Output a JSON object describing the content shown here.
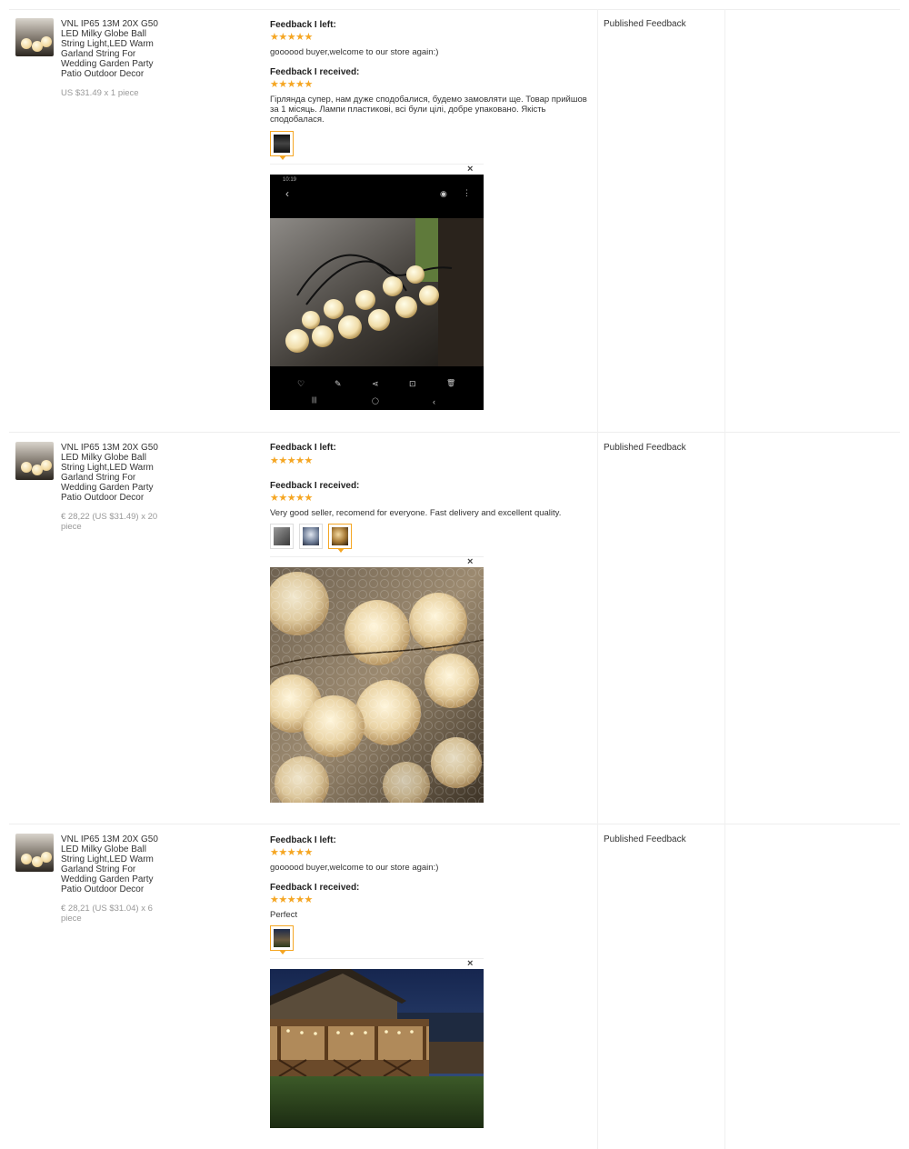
{
  "rows": [
    {
      "product_title": "VNL IP65 13M 20X G50 LED Milky Globe Ball String Light,LED Warm Garland String For Wedding Garden Party Patio Outdoor Decor",
      "price": "US $31.49 x 1 piece",
      "left_label": "Feedback I left:",
      "left_stars": "★★★★★",
      "left_text": "goooood buyer,welcome to our store again:)",
      "received_label": "Feedback I received:",
      "received_stars": "★★★★★",
      "received_text": "Гірлянда супер, нам дуже сподобалися, будемо замовляти ще. Товар прийшов за 1 місяць. Лампи пластикові, всі були цілі, добре упаковано. Якість сподобалася.",
      "status": "Published Feedback",
      "close_glyph": "×"
    },
    {
      "product_title": "VNL IP65 13M 20X G50 LED Milky Globe Ball String Light,LED Warm Garland String For Wedding Garden Party Patio Outdoor Decor",
      "price": "€ 28,22 (US $31.49) x 20 piece",
      "left_label": "Feedback I left:",
      "left_stars": "★★★★★",
      "received_label": "Feedback I received:",
      "received_stars": "★★★★★",
      "received_text": "Very good seller, recomend for everyone. Fast delivery and excellent quality.",
      "status": "Published Feedback",
      "close_glyph": "×"
    },
    {
      "product_title": "VNL IP65 13M 20X G50 LED Milky Globe Ball String Light,LED Warm Garland String For Wedding Garden Party Patio Outdoor Decor",
      "price": "€ 28,21 (US $31.04) x 6 piece",
      "left_label": "Feedback I left:",
      "left_stars": "★★★★★",
      "left_text": "goooood buyer,welcome to our store again:)",
      "received_label": "Feedback I received:",
      "received_stars": "★★★★★",
      "received_text": "Perfect",
      "status": "Published Feedback",
      "close_glyph": "×"
    }
  ],
  "phone_ui": {
    "status_time": "10:19",
    "back_glyph": "‹",
    "eye_glyph": "◉",
    "menu_glyph": "⋮",
    "toolbar": [
      "♡",
      "✎",
      "⋖",
      "⊡",
      "🗑"
    ],
    "nav": [
      "|||",
      "◯",
      "‹"
    ]
  },
  "colors": {
    "star": "#f5a623",
    "border": "#eeeeee",
    "muted": "#999999"
  }
}
